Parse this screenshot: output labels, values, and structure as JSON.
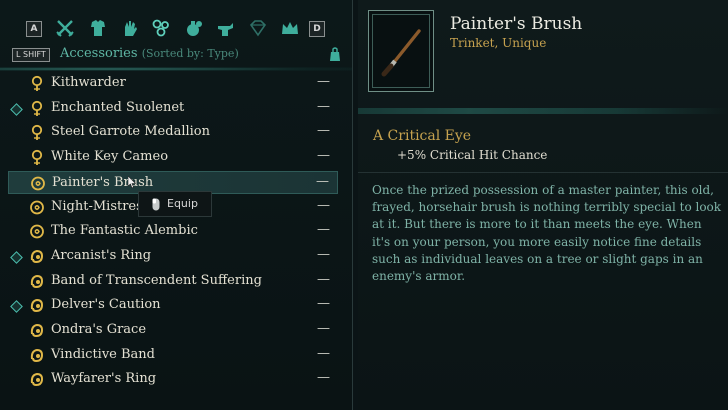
{
  "categories": {
    "prev_key": "A",
    "next_key": "D",
    "icons": [
      "swords-icon",
      "armor-icon",
      "hand-icon",
      "accessories-icon",
      "potion-icon",
      "crafting-icon",
      "gem-icon",
      "crown-icon"
    ]
  },
  "header": {
    "key": "L SHIFT",
    "title": "Accessories",
    "sort": "(Sorted by: Type)"
  },
  "colors": {
    "accent": "#5fb7a5",
    "gold": "#c6a24f",
    "description": "#7fb3a7"
  },
  "items": [
    {
      "label": "Kithwarder",
      "dash": "—",
      "icon": "amulet-icon",
      "new": false
    },
    {
      "label": "Enchanted Suolenet",
      "dash": "—",
      "icon": "amulet-icon",
      "new": true
    },
    {
      "label": "Steel Garrote Medallion",
      "dash": "—",
      "icon": "amulet-icon",
      "new": false
    },
    {
      "label": "White Key Cameo",
      "dash": "—",
      "icon": "amulet-icon",
      "new": false
    },
    {
      "label": "Painter's Brush",
      "dash": "—",
      "icon": "trinket-icon",
      "new": false,
      "selected": true
    },
    {
      "label": "Night-Mistress",
      "dash": "—",
      "icon": "trinket-icon",
      "new": false
    },
    {
      "label": "The Fantastic Alembic",
      "dash": "—",
      "icon": "trinket-icon",
      "new": false
    },
    {
      "label": "Arcanist's Ring",
      "dash": "—",
      "icon": "ring-icon",
      "new": true
    },
    {
      "label": "Band of Transcendent Suffering",
      "dash": "—",
      "icon": "ring-icon",
      "new": false
    },
    {
      "label": "Delver's Caution",
      "dash": "—",
      "icon": "ring-icon",
      "new": true
    },
    {
      "label": "Ondra's Grace",
      "dash": "—",
      "icon": "ring-icon",
      "new": false
    },
    {
      "label": "Vindictive Band",
      "dash": "—",
      "icon": "ring-icon",
      "new": false
    },
    {
      "label": "Wayfarer's Ring",
      "dash": "—",
      "icon": "ring-icon",
      "new": false
    }
  ],
  "tooltip": {
    "label": "Equip"
  },
  "detail": {
    "name": "Painter's Brush",
    "type": "Trinket, Unique",
    "trait_name": "A Critical Eye",
    "trait_effect": "+5% Critical Hit Chance",
    "description": "Once the prized possession of a master painter, this old, frayed, horsehair brush is nothing terribly special to look at it. But there is more to it than meets the eye. When it's on your person, you more easily notice fine details such as individual leaves on a tree or slight gaps in an enemy's armor."
  }
}
